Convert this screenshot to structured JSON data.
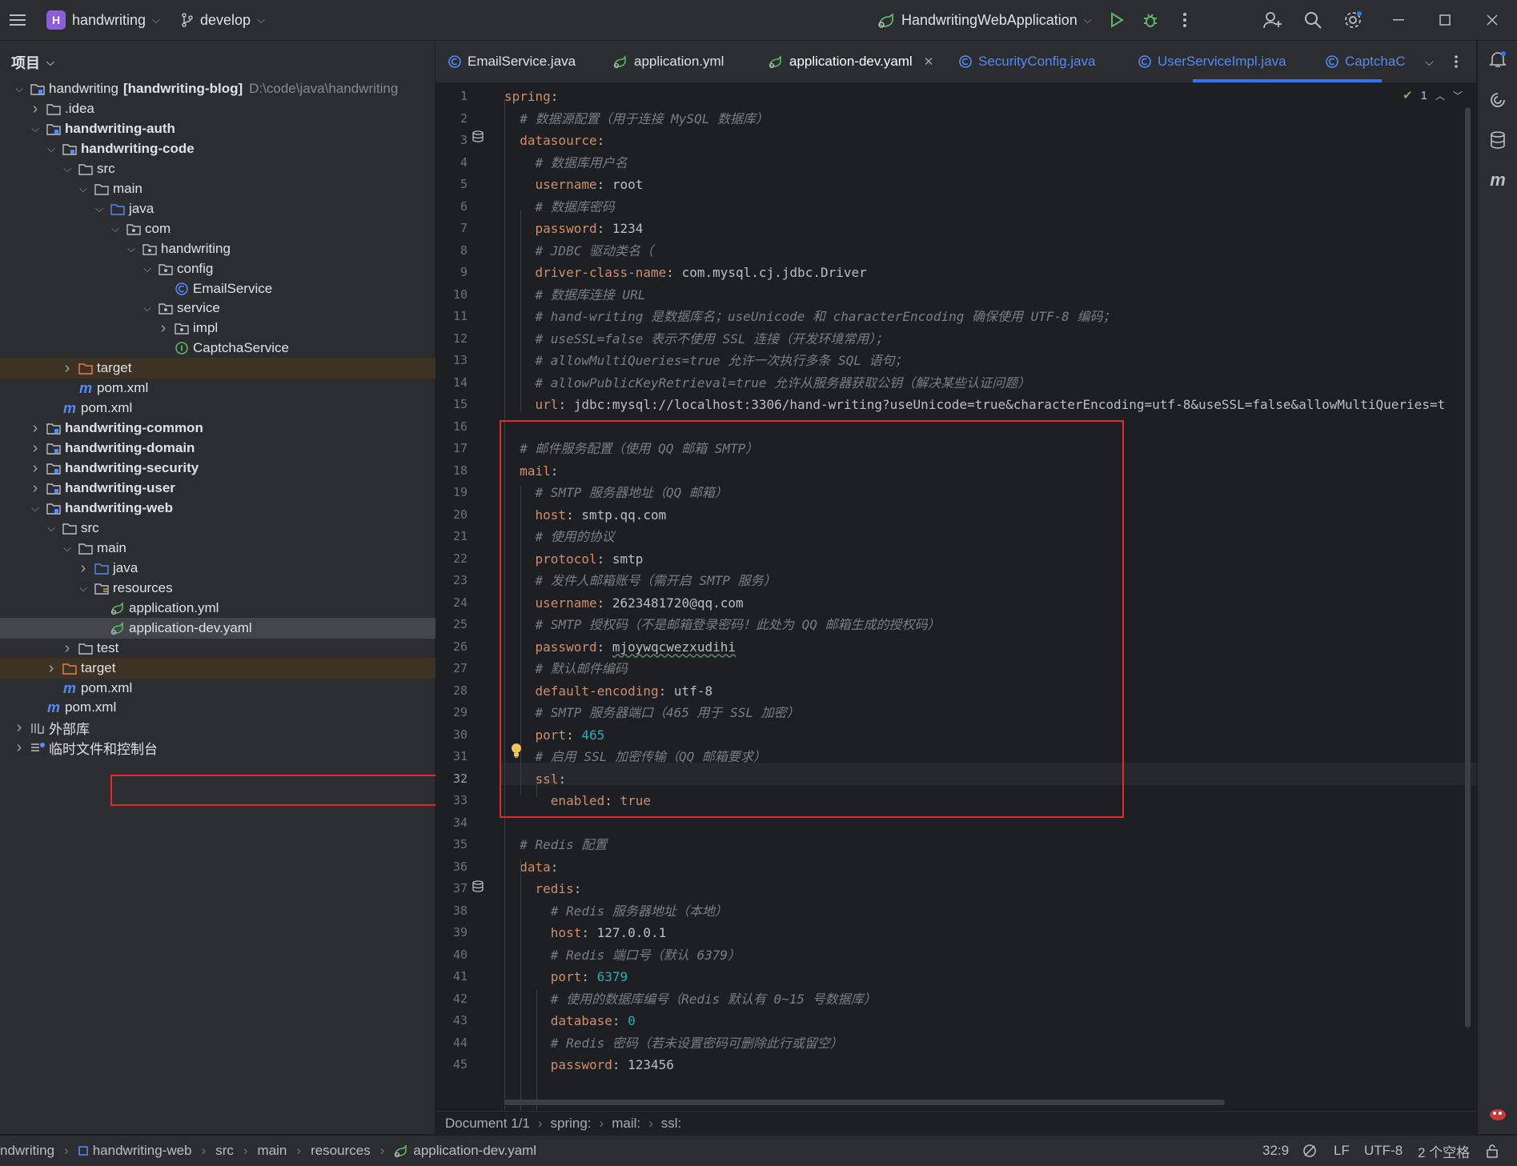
{
  "titlebar": {
    "project_badge": "H",
    "project_name": "handwriting",
    "branch": "develop",
    "run_config": "HandwritingWebApplication"
  },
  "project_panel": {
    "header": "项目",
    "tree": [
      {
        "label": "handwriting",
        "suffix": "[handwriting-blog]",
        "path": "D:\\code\\java\\handwriting"
      },
      {
        "label": ".idea"
      },
      {
        "label": "handwriting-auth"
      },
      {
        "label": "handwriting-code"
      },
      {
        "label": "src"
      },
      {
        "label": "main"
      },
      {
        "label": "java"
      },
      {
        "label": "com"
      },
      {
        "label": "handwriting"
      },
      {
        "label": "config"
      },
      {
        "label": "EmailService"
      },
      {
        "label": "service"
      },
      {
        "label": "impl"
      },
      {
        "label": "CaptchaService"
      },
      {
        "label": "target"
      },
      {
        "label": "pom.xml"
      },
      {
        "label": "pom.xml"
      },
      {
        "label": "handwriting-common"
      },
      {
        "label": "handwriting-domain"
      },
      {
        "label": "handwriting-security"
      },
      {
        "label": "handwriting-user"
      },
      {
        "label": "handwriting-web"
      },
      {
        "label": "src"
      },
      {
        "label": "main"
      },
      {
        "label": "java"
      },
      {
        "label": "resources"
      },
      {
        "label": "application.yml"
      },
      {
        "label": "application-dev.yaml"
      },
      {
        "label": "test"
      },
      {
        "label": "target"
      },
      {
        "label": "pom.xml"
      },
      {
        "label": "pom.xml"
      },
      {
        "label": "外部库"
      },
      {
        "label": "临时文件和控制台"
      }
    ]
  },
  "tabs": [
    {
      "label": "EmailService.java"
    },
    {
      "label": "application.yml"
    },
    {
      "label": "application-dev.yaml"
    },
    {
      "label": "SecurityConfig.java"
    },
    {
      "label": "UserServiceImpl.java"
    },
    {
      "label": "CaptchaC"
    }
  ],
  "editor": {
    "inspection_count": "1",
    "current_line": 32,
    "lines": [
      {
        "n": "1",
        "t": [
          [
            "k",
            "spring"
          ],
          [
            "v",
            ":"
          ]
        ]
      },
      {
        "n": "2",
        "t": [
          [
            "v",
            "  "
          ],
          [
            "c",
            "# 数据源配置（用于连接 MySQL 数据库）"
          ]
        ]
      },
      {
        "n": "3",
        "t": [
          [
            "v",
            "  "
          ],
          [
            "k",
            "datasource"
          ],
          [
            "v",
            ":"
          ]
        ]
      },
      {
        "n": "4",
        "t": [
          [
            "v",
            "    "
          ],
          [
            "c",
            "# 数据库用户名"
          ]
        ]
      },
      {
        "n": "5",
        "t": [
          [
            "v",
            "    "
          ],
          [
            "k",
            "username"
          ],
          [
            "v",
            ": root"
          ]
        ]
      },
      {
        "n": "6",
        "t": [
          [
            "v",
            "    "
          ],
          [
            "c",
            "# 数据库密码"
          ]
        ]
      },
      {
        "n": "7",
        "t": [
          [
            "v",
            "    "
          ],
          [
            "k",
            "password"
          ],
          [
            "v",
            ": 1234"
          ]
        ]
      },
      {
        "n": "8",
        "t": [
          [
            "v",
            "    "
          ],
          [
            "c",
            "# JDBC 驱动类名（"
          ]
        ]
      },
      {
        "n": "9",
        "t": [
          [
            "v",
            "    "
          ],
          [
            "k",
            "driver-class-name"
          ],
          [
            "v",
            ": com.mysql.cj.jdbc.Driver"
          ]
        ]
      },
      {
        "n": "10",
        "t": [
          [
            "v",
            "    "
          ],
          [
            "c",
            "# 数据库连接 URL"
          ]
        ]
      },
      {
        "n": "11",
        "t": [
          [
            "v",
            "    "
          ],
          [
            "c",
            "# hand-writing 是数据库名；useUnicode 和 characterEncoding 确保使用 UTF-8 编码；"
          ]
        ]
      },
      {
        "n": "12",
        "t": [
          [
            "v",
            "    "
          ],
          [
            "c",
            "# useSSL=false 表示不使用 SSL 连接（开发环境常用）；"
          ]
        ]
      },
      {
        "n": "13",
        "t": [
          [
            "v",
            "    "
          ],
          [
            "c",
            "# allowMultiQueries=true 允许一次执行多条 SQL 语句；"
          ]
        ]
      },
      {
        "n": "14",
        "t": [
          [
            "v",
            "    "
          ],
          [
            "c",
            "# allowPublicKeyRetrieval=true 允许从服务器获取公钥（解决某些认证问题）"
          ]
        ]
      },
      {
        "n": "15",
        "t": [
          [
            "v",
            "    "
          ],
          [
            "k",
            "url"
          ],
          [
            "v",
            ": jdbc:mysql://localhost:3306/hand-writing?useUnicode=true&characterEncoding=utf-8&useSSL=false&allowMultiQueries=t"
          ]
        ]
      },
      {
        "n": "16",
        "t": []
      },
      {
        "n": "17",
        "t": [
          [
            "v",
            "  "
          ],
          [
            "c",
            "# 邮件服务配置（使用 QQ 邮箱 SMTP）"
          ]
        ]
      },
      {
        "n": "18",
        "t": [
          [
            "v",
            "  "
          ],
          [
            "k",
            "mail"
          ],
          [
            "v",
            ":"
          ]
        ]
      },
      {
        "n": "19",
        "t": [
          [
            "v",
            "    "
          ],
          [
            "c",
            "# SMTP 服务器地址（QQ 邮箱）"
          ]
        ]
      },
      {
        "n": "20",
        "t": [
          [
            "v",
            "    "
          ],
          [
            "k",
            "host"
          ],
          [
            "v",
            ": smtp.qq.com"
          ]
        ]
      },
      {
        "n": "21",
        "t": [
          [
            "v",
            "    "
          ],
          [
            "c",
            "# 使用的协议"
          ]
        ]
      },
      {
        "n": "22",
        "t": [
          [
            "v",
            "    "
          ],
          [
            "k",
            "protocol"
          ],
          [
            "v",
            ": smtp"
          ]
        ]
      },
      {
        "n": "23",
        "t": [
          [
            "v",
            "    "
          ],
          [
            "c",
            "# 发件人邮箱账号（需开启 SMTP 服务）"
          ]
        ]
      },
      {
        "n": "24",
        "t": [
          [
            "v",
            "    "
          ],
          [
            "k",
            "username"
          ],
          [
            "v",
            ": 2623481720@qq.com"
          ]
        ]
      },
      {
        "n": "25",
        "t": [
          [
            "v",
            "    "
          ],
          [
            "c",
            "# SMTP 授权码（不是邮箱登录密码！此处为 QQ 邮箱生成的授权码）"
          ]
        ]
      },
      {
        "n": "26",
        "t": [
          [
            "v",
            "    "
          ],
          [
            "k",
            "password"
          ],
          [
            "v",
            ": "
          ],
          [
            "u",
            "mjoywqcwezxudihi"
          ]
        ]
      },
      {
        "n": "27",
        "t": [
          [
            "v",
            "    "
          ],
          [
            "c",
            "# 默认邮件编码"
          ]
        ]
      },
      {
        "n": "28",
        "t": [
          [
            "v",
            "    "
          ],
          [
            "k",
            "default-encoding"
          ],
          [
            "v",
            ": utf-8"
          ]
        ]
      },
      {
        "n": "29",
        "t": [
          [
            "v",
            "    "
          ],
          [
            "c",
            "# SMTP 服务器端口（465 用于 SSL 加密）"
          ]
        ]
      },
      {
        "n": "30",
        "t": [
          [
            "v",
            "    "
          ],
          [
            "k",
            "port"
          ],
          [
            "v",
            ": "
          ],
          [
            "n",
            "465"
          ]
        ]
      },
      {
        "n": "31",
        "t": [
          [
            "v",
            "    "
          ],
          [
            "c",
            "# 启用 SSL 加密传输（QQ 邮箱要求）"
          ]
        ]
      },
      {
        "n": "32",
        "t": [
          [
            "v",
            "    "
          ],
          [
            "k",
            "ssl"
          ],
          [
            "v",
            ":"
          ]
        ]
      },
      {
        "n": "33",
        "t": [
          [
            "v",
            "      "
          ],
          [
            "k",
            "enabled"
          ],
          [
            "v",
            ": "
          ],
          [
            "k",
            "true"
          ]
        ]
      },
      {
        "n": "34",
        "t": []
      },
      {
        "n": "35",
        "t": [
          [
            "v",
            "  "
          ],
          [
            "c",
            "# Redis 配置"
          ]
        ]
      },
      {
        "n": "36",
        "t": [
          [
            "v",
            "  "
          ],
          [
            "k",
            "data"
          ],
          [
            "v",
            ":"
          ]
        ]
      },
      {
        "n": "37",
        "t": [
          [
            "v",
            "    "
          ],
          [
            "k",
            "redis"
          ],
          [
            "v",
            ":"
          ]
        ]
      },
      {
        "n": "38",
        "t": [
          [
            "v",
            "      "
          ],
          [
            "c",
            "# Redis 服务器地址（本地）"
          ]
        ]
      },
      {
        "n": "39",
        "t": [
          [
            "v",
            "      "
          ],
          [
            "k",
            "host"
          ],
          [
            "v",
            ": 127.0.0.1"
          ]
        ]
      },
      {
        "n": "40",
        "t": [
          [
            "v",
            "      "
          ],
          [
            "c",
            "# Redis 端口号（默认 6379）"
          ]
        ]
      },
      {
        "n": "41",
        "t": [
          [
            "v",
            "      "
          ],
          [
            "k",
            "port"
          ],
          [
            "v",
            ": "
          ],
          [
            "n",
            "6379"
          ]
        ]
      },
      {
        "n": "42",
        "t": [
          [
            "v",
            "      "
          ],
          [
            "c",
            "# 使用的数据库编号（Redis 默认有 0~15 号数据库）"
          ]
        ]
      },
      {
        "n": "43",
        "t": [
          [
            "v",
            "      "
          ],
          [
            "k",
            "database"
          ],
          [
            "v",
            ": "
          ],
          [
            "n",
            "0"
          ]
        ]
      },
      {
        "n": "44",
        "t": [
          [
            "v",
            "      "
          ],
          [
            "c",
            "# Redis 密码（若未设置密码可删除此行或留空）"
          ]
        ]
      },
      {
        "n": "45",
        "t": [
          [
            "v",
            "      "
          ],
          [
            "k",
            "password"
          ],
          [
            "v",
            ": 123456"
          ]
        ]
      }
    ]
  },
  "editor_breadcrumb": {
    "doc": "Document 1/1",
    "items": [
      "spring:",
      "mail:",
      "ssl:"
    ]
  },
  "statusbar": {
    "crumbs": [
      "ndwriting",
      "handwriting-web",
      "src",
      "main",
      "resources",
      "application-dev.yaml"
    ],
    "position": "32:9",
    "line_sep": "LF",
    "encoding": "UTF-8",
    "indent": "2 个空格"
  },
  "colors": {
    "accent": "#3574f0",
    "highlight_box": "#e5282b",
    "yaml_key": "#cf8e6d",
    "comment": "#7a7e85",
    "number": "#2aacb8"
  }
}
